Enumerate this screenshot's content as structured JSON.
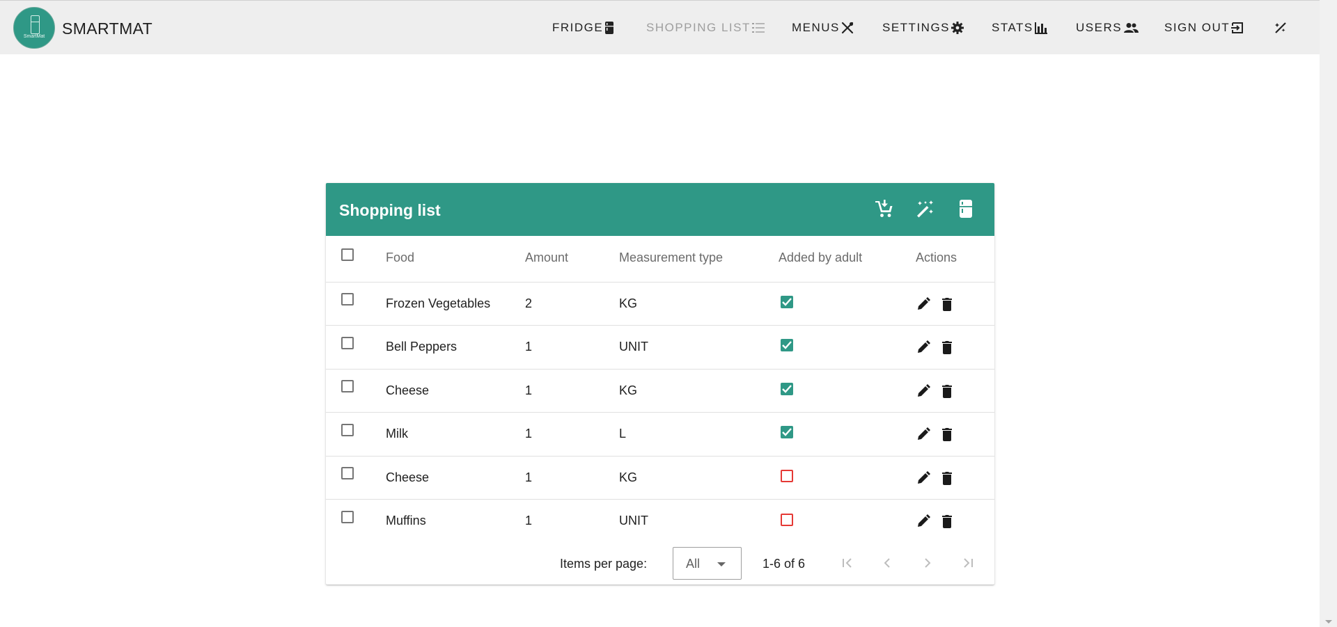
{
  "app": {
    "brand": "SMARTMAT",
    "logo_text": "SmartMat"
  },
  "nav": [
    {
      "label": "FRIDGE",
      "icon": "fridge-icon",
      "active": false
    },
    {
      "label": "SHOPPING LIST",
      "icon": "list-icon",
      "active": true
    },
    {
      "label": "MENUS",
      "icon": "utensils-icon",
      "active": false
    },
    {
      "label": "SETTINGS",
      "icon": "gear-icon",
      "active": false
    },
    {
      "label": "STATS",
      "icon": "bar-chart-icon",
      "active": false
    },
    {
      "label": "USERS",
      "icon": "users-icon",
      "active": false
    },
    {
      "label": "SIGN OUT",
      "icon": "sign-out-icon",
      "active": false
    },
    {
      "label": "",
      "icon": "theme-toggle-icon",
      "active": false
    }
  ],
  "card": {
    "title": "Shopping list",
    "header_actions": [
      "add-to-cart-icon",
      "magic-wand-icon",
      "fridge-icon"
    ]
  },
  "table": {
    "columns": [
      "Food",
      "Amount",
      "Measurement type",
      "Added by adult",
      "Actions"
    ],
    "rows": [
      {
        "food": "Frozen Vegetables",
        "amount": "2",
        "measurement": "KG",
        "added_by_adult": true
      },
      {
        "food": "Bell Peppers",
        "amount": "1",
        "measurement": "UNIT",
        "added_by_adult": true
      },
      {
        "food": "Cheese",
        "amount": "1",
        "measurement": "KG",
        "added_by_adult": true
      },
      {
        "food": "Milk",
        "amount": "1",
        "measurement": "L",
        "added_by_adult": true
      },
      {
        "food": "Cheese",
        "amount": "1",
        "measurement": "KG",
        "added_by_adult": false
      },
      {
        "food": "Muffins",
        "amount": "1",
        "measurement": "UNIT",
        "added_by_adult": false
      }
    ]
  },
  "footer": {
    "items_per_page_label": "Items per page:",
    "items_per_page_value": "All",
    "range_text": "1-6 of 6"
  },
  "colors": {
    "accent": "#2f9886",
    "unchecked_flag": "#e53935",
    "topbar": "#eeeeee"
  }
}
